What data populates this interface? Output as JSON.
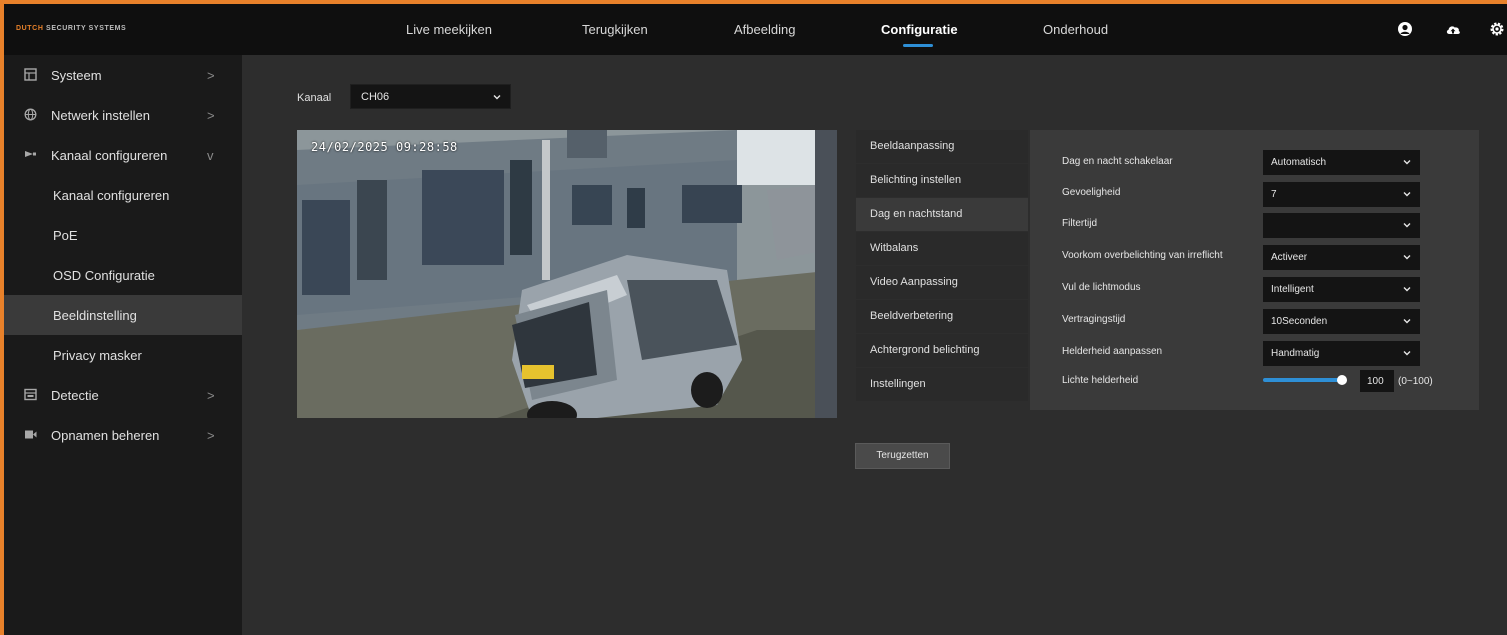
{
  "brand": {
    "prefix": "DUTCH",
    "suffix": "SECURITY SYSTEMS"
  },
  "nav": [
    {
      "label": "Live meekijken",
      "active": false
    },
    {
      "label": "Terugkijken",
      "active": false
    },
    {
      "label": "Afbeelding",
      "active": false
    },
    {
      "label": "Configuratie",
      "active": true
    },
    {
      "label": "Onderhoud",
      "active": false
    }
  ],
  "top_icons": [
    "user-icon",
    "cloud-upload-icon",
    "gear-icon"
  ],
  "sidebar": {
    "items": [
      {
        "label": "Systeem",
        "icon": "system-icon",
        "chevron": ">"
      },
      {
        "label": "Netwerk instellen",
        "icon": "network-icon",
        "chevron": ">"
      },
      {
        "label": "Kanaal configureren",
        "icon": "camera-icon",
        "chevron": "v"
      },
      {
        "label": "Kanaal configureren"
      },
      {
        "label": "PoE"
      },
      {
        "label": "OSD Configuratie"
      },
      {
        "label": "Beeldinstelling",
        "selected": true
      },
      {
        "label": "Privacy masker"
      },
      {
        "label": "Detectie",
        "icon": "detection-icon",
        "chevron": ">"
      },
      {
        "label": "Opnamen beheren",
        "icon": "record-icon",
        "chevron": ">"
      }
    ]
  },
  "channel": {
    "label": "Kanaal",
    "value": "CH06"
  },
  "preview": {
    "timestamp": "24/02/2025  09:28:58"
  },
  "tabs": [
    {
      "label": "Beeldaanpassing"
    },
    {
      "label": "Belichting instellen"
    },
    {
      "label": "Dag en nachtstand",
      "active": true
    },
    {
      "label": "Witbalans"
    },
    {
      "label": "Video Aanpassing"
    },
    {
      "label": "Beeldverbetering"
    },
    {
      "label": "Achtergrond belichting"
    },
    {
      "label": "Instellingen"
    }
  ],
  "settings": {
    "rows": [
      {
        "label": "Dag en nacht schakelaar",
        "value": "Automatisch"
      },
      {
        "label": "Gevoeligheid",
        "value": "7"
      },
      {
        "label": "Filtertijd",
        "value": ""
      },
      {
        "label": "Voorkom overbelichting van irreflicht",
        "value": "Activeer"
      },
      {
        "label": "Vul de lichtmodus",
        "value": "Intelligent"
      },
      {
        "label": "Vertragingstijd",
        "value": "10Seconden"
      },
      {
        "label": "Helderheid aanpassen",
        "value": "Handmatig"
      }
    ],
    "brightness": {
      "label": "Lichte helderheid",
      "value": "100",
      "range": "(0~100)",
      "level": 1.0
    }
  },
  "reset_label": "Terugzetten",
  "colors": {
    "accent": "#2e8fd6",
    "frame": "#e8812a",
    "topbar": "#0f0f0f",
    "sidebar": "#1a1a1a",
    "panel": "#3a3a3a"
  }
}
